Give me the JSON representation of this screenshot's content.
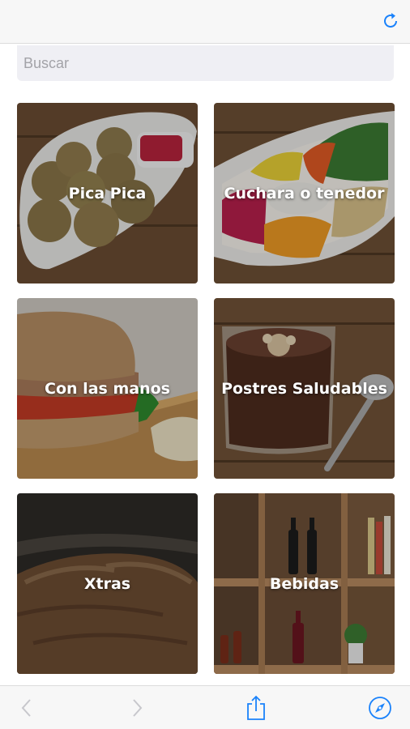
{
  "search": {
    "placeholder": "Buscar"
  },
  "categories": [
    {
      "label": "Pica Pica"
    },
    {
      "label": "Cuchara o tenedor"
    },
    {
      "label": "Con las manos"
    },
    {
      "label": "Postres Saludables"
    },
    {
      "label": "Xtras"
    },
    {
      "label": "Bebidas"
    }
  ],
  "colors": {
    "accent": "#1a82fb",
    "disabled": "#c7c7cc"
  },
  "icons": {
    "refresh": "refresh-icon",
    "back": "chevron-left-icon",
    "forward": "chevron-right-icon",
    "share": "share-icon",
    "safari": "compass-icon"
  }
}
